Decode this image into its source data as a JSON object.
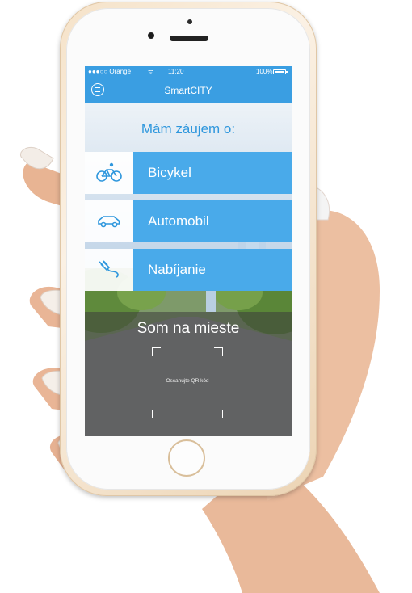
{
  "status_bar": {
    "carrier": "●●●○○ Orange",
    "wifi_icon": "wifi-icon",
    "time": "11:20",
    "battery_percent": "100%"
  },
  "nav": {
    "title": "SmartCITY",
    "menu_icon": "menu-icon"
  },
  "section_title": "Mám záujem o:",
  "options": [
    {
      "label": "Bicykel",
      "icon": "bicycle-icon"
    },
    {
      "label": "Automobil",
      "icon": "car-icon"
    },
    {
      "label": "Nabíjanie",
      "icon": "charging-plug-icon"
    }
  ],
  "checkin": {
    "title": "Som na mieste",
    "qr_hint": "Oscanujte QR kód"
  },
  "colors": {
    "primary_blue": "#3a9ee2",
    "option_blue": "#49aaea",
    "phone_gold": "#f5e2c8"
  }
}
